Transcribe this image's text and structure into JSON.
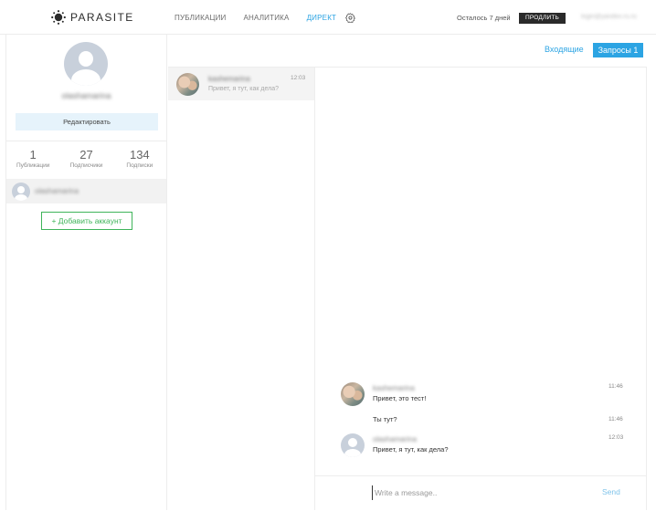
{
  "brand": {
    "name": "PARASITE"
  },
  "nav": {
    "items": [
      {
        "label": "ПУБЛИКАЦИИ",
        "active": false
      },
      {
        "label": "АНАЛИТИКА",
        "active": false
      },
      {
        "label": "ДИРЕКТ",
        "active": true
      }
    ],
    "settings_icon": "gear-icon"
  },
  "account_bar": {
    "remaining": "Осталось 7 дней",
    "extend_label": "ПРОДЛИТЬ",
    "email": "login@yandex.ru.ru"
  },
  "profile": {
    "username": "olashamarina",
    "edit_label": "Редактировать",
    "stats": [
      {
        "value": "1",
        "label": "Публикации"
      },
      {
        "value": "27",
        "label": "Подписчики"
      },
      {
        "value": "134",
        "label": "Подписки"
      }
    ],
    "account_item": {
      "name": "olashamarina"
    },
    "add_account_label": "+ Добавить аккаунт"
  },
  "tabs": {
    "inbox": "Входящие",
    "requests": "Запросы 1"
  },
  "conversations": [
    {
      "name": "kashemarina",
      "time": "12:03",
      "preview": "Привет, я тут, как дела?"
    }
  ],
  "messages": [
    {
      "sender": "kashemarina",
      "text": "Привет, это тест!",
      "time": "11:46",
      "avatar": "photo"
    },
    {
      "sender": "",
      "text": "Ты тут?",
      "time": "11:46",
      "avatar": "none"
    },
    {
      "sender": "olashamarina",
      "text": "Привет, я тут, как дела?",
      "time": "12:03",
      "avatar": "default"
    }
  ],
  "composer": {
    "placeholder": "Write a message..",
    "send_label": "Send"
  },
  "colors": {
    "accent": "#2ca4e3",
    "add_account": "#3fb45a",
    "edit_bg": "#e6f3fb",
    "extend_bg": "#2a2a2a"
  }
}
